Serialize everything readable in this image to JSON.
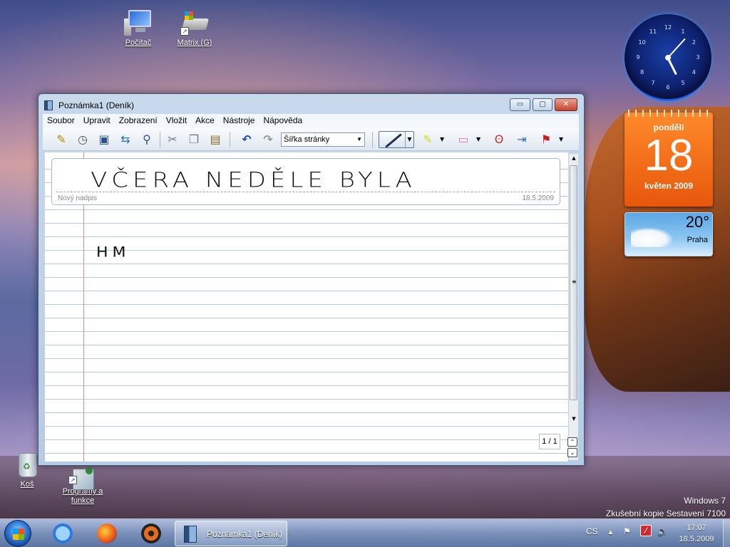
{
  "desktop": {
    "icons": [
      {
        "label": "Počítač"
      },
      {
        "label": "Matrix (G)"
      },
      {
        "label": "Koš"
      },
      {
        "label": "Programy a funkce"
      }
    ],
    "watermark": {
      "line1": "Windows 7",
      "line2": "Zkušební kopie Sestavení 7100"
    }
  },
  "gadgets": {
    "clock": {
      "numbers": [
        "12",
        "1",
        "2",
        "3",
        "4",
        "5",
        "6",
        "7",
        "8",
        "9",
        "10",
        "11"
      ],
      "time_hours": 17,
      "time_minutes": 7
    },
    "calendar": {
      "day_name": "pondělí",
      "day_number": "18",
      "month_year": "květen 2009"
    },
    "weather": {
      "temperature": "20°",
      "city": "Praha"
    }
  },
  "window": {
    "title": "Poznámka1 (Deník)",
    "controls": {
      "minimize": "▭",
      "maximize": "▢",
      "close": "✕"
    },
    "menu": [
      "Soubor",
      "Upravit",
      "Zobrazení",
      "Vložit",
      "Akce",
      "Nástroje",
      "Nápověda"
    ],
    "toolbar": {
      "zoom_value": "Šířka stránky",
      "icons": [
        "new-note-icon",
        "new-page-icon",
        "save-icon",
        "send-icon",
        "find-icon",
        "cut-icon",
        "copy-icon",
        "paste-icon",
        "undo-icon",
        "redo-icon",
        "pen-icon",
        "highlighter-icon",
        "eraser-icon",
        "lasso-icon",
        "insert-space-icon",
        "flag-icon"
      ]
    },
    "note": {
      "title_ink": "VČERA NEDĚLE BYLA",
      "title_placeholder": "Nový nadpis",
      "date": "18.5.2009",
      "body_ink": "HM"
    },
    "page_indicator": "1 / 1"
  },
  "taskbar": {
    "active_item": "Poznámka1 (Deník)",
    "language": "CS",
    "clock_time": "17:07",
    "clock_date": "18.5.2009",
    "colors": {
      "accent": "#2f7ad8"
    }
  }
}
